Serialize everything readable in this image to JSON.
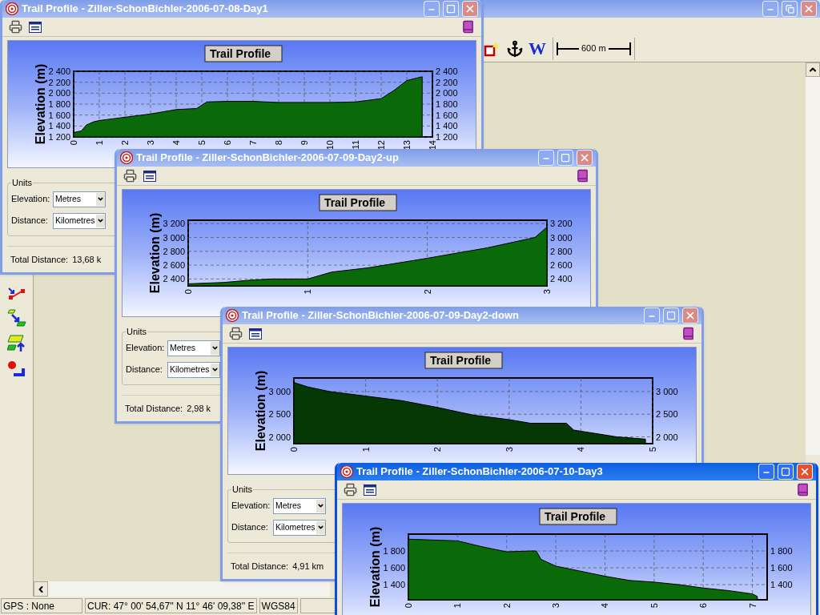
{
  "main_window": {
    "active": false,
    "toolbar": {
      "letter_tool": "W",
      "scale": "600 m"
    },
    "status_bar": [
      "GPS : None",
      "CUR: 47° 00' 54,67'' N 11° 46' 09,38'' E",
      "WGS84"
    ]
  },
  "profile_windows": [
    {
      "title": "Trail Profile - Ziller-SchonBichler-2006-07-08-Day1",
      "active": false,
      "chart_data": {
        "type": "area",
        "title": "Trail Profile",
        "ylabel": "Elevation (m)",
        "x": [
          0,
          0.3,
          0.5,
          0.8,
          1,
          2,
          3,
          4,
          4.8,
          5.2,
          6,
          7,
          8,
          9,
          10,
          11,
          12,
          12.5,
          13,
          13.6
        ],
        "grid": true,
        "series": [
          {
            "color": "#0a6a0a",
            "values": [
              1280,
              1310,
              1420,
              1480,
              1500,
              1560,
              1620,
              1700,
              1720,
              1840,
              1850,
              1850,
              1830,
              1830,
              1830,
              1840,
              1900,
              2050,
              2230,
              2300
            ]
          }
        ],
        "xlim": [
          0,
          14
        ],
        "ylim": [
          1200,
          2400
        ],
        "xticks": [
          0,
          1,
          2,
          3,
          4,
          5,
          6,
          7,
          8,
          9,
          10,
          11,
          12,
          13,
          14
        ],
        "yticks": [
          {
            "value": 1200,
            "label": "1 200"
          },
          {
            "value": 1400,
            "label": "1 400"
          },
          {
            "value": 1600,
            "label": "1 600"
          },
          {
            "value": 1800,
            "label": "1 800"
          },
          {
            "value": 2000,
            "label": "2 000"
          },
          {
            "value": 2200,
            "label": "2 200"
          },
          {
            "value": 2400,
            "label": "2 400"
          }
        ]
      },
      "units_label": "Units",
      "elevation_label": "Elevation:",
      "elevation_value": "Metres",
      "distance_label": "Distance:",
      "distance_value": "Kilometres",
      "total_label": "Total Distance:",
      "total_value": "13,68 k"
    },
    {
      "title": "Trail Profile - Ziller-SchonBichler-2006-07-09-Day2-up",
      "active": false,
      "chart_data": {
        "type": "area",
        "title": "Trail Profile",
        "ylabel": "Elevation (m)",
        "x": [
          0,
          0.3,
          0.5,
          0.7,
          1,
          1.2,
          1.5,
          2,
          2.5,
          2.9,
          3
        ],
        "grid": true,
        "series": [
          {
            "color": "#0a6a0a",
            "values": [
              2330,
              2350,
              2380,
              2400,
              2400,
              2500,
              2560,
              2700,
              2850,
              3000,
              3150
            ]
          }
        ],
        "xlim": [
          0,
          3
        ],
        "ylim": [
          2300,
          3250
        ],
        "xticks": [
          0,
          1,
          2,
          3
        ],
        "yticks": [
          {
            "value": 2400,
            "label": "2 400"
          },
          {
            "value": 2600,
            "label": "2 600"
          },
          {
            "value": 2800,
            "label": "2 800"
          },
          {
            "value": 3000,
            "label": "3 000"
          },
          {
            "value": 3200,
            "label": "3 200"
          }
        ]
      },
      "units_label": "Units",
      "elevation_label": "Elevation:",
      "elevation_value": "Metres",
      "distance_label": "Distance:",
      "distance_value": "Kilometres",
      "total_label": "Total Distance:",
      "total_value": "2,98 k"
    },
    {
      "title": "Trail Profile - Ziller-SchonBichler-2006-07-09-Day2-down",
      "active": false,
      "chart_data": {
        "type": "area",
        "title": "Trail Profile",
        "ylabel": "Elevation (m)",
        "x": [
          0,
          0.2,
          0.5,
          1,
          1.5,
          2,
          2.5,
          3,
          3.3,
          3.8,
          3.9,
          4.5,
          4.9
        ],
        "grid": true,
        "series": [
          {
            "color": "#063806",
            "values": [
              3200,
              3100,
              3000,
              2900,
              2800,
              2650,
              2480,
              2380,
              2300,
              2300,
              2150,
              2000,
              1950
            ]
          }
        ],
        "xlim": [
          0,
          5
        ],
        "ylim": [
          1850,
          3300
        ],
        "xticks": [
          0,
          1,
          2,
          3,
          4,
          5
        ],
        "yticks": [
          {
            "value": 2000,
            "label": "2 000"
          },
          {
            "value": 2500,
            "label": "2 500"
          },
          {
            "value": 3000,
            "label": "3 000"
          }
        ]
      },
      "units_label": "Units",
      "elevation_label": "Elevation:",
      "elevation_value": "Metres",
      "distance_label": "Distance:",
      "distance_value": "Kilometres",
      "total_label": "Total Distance:",
      "total_value": "4,91 km"
    },
    {
      "title": "Trail Profile - Ziller-SchonBichler-2006-07-10-Day3",
      "active": true,
      "chart_data": {
        "type": "area",
        "title": "Trail Profile",
        "ylabel": "Elevation (m)",
        "x": [
          0,
          0.5,
          1,
          1.5,
          2,
          2.5,
          2.6,
          2.7,
          3,
          3.5,
          4,
          4.5,
          5,
          5.5,
          6,
          6.5,
          7,
          7.1
        ],
        "grid": true,
        "series": [
          {
            "color": "#0a6a0a",
            "values": [
              1940,
              1930,
              1920,
              1850,
              1790,
              1800,
              1800,
              1700,
              1620,
              1560,
              1500,
              1450,
              1430,
              1400,
              1360,
              1330,
              1290,
              1260
            ]
          }
        ],
        "xlim": [
          0,
          7.3
        ],
        "ylim": [
          1220,
          2000
        ],
        "xticks": [
          0,
          1,
          2,
          3,
          4,
          5,
          6,
          7
        ],
        "yticks": [
          {
            "value": 1400,
            "label": "1 400"
          },
          {
            "value": 1600,
            "label": "1 600"
          },
          {
            "value": 1800,
            "label": "1 800"
          }
        ]
      }
    }
  ]
}
